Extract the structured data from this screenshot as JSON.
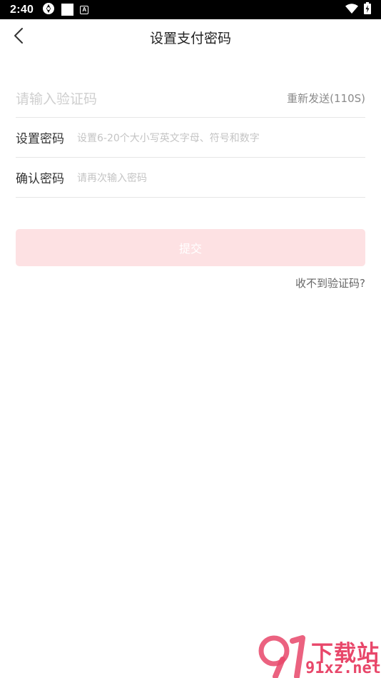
{
  "status_bar": {
    "time": "2:40",
    "icons_left": [
      "sync-icon",
      "white-square-icon",
      "app-notification-icon"
    ],
    "app_badge_letter": "A",
    "icons_right": [
      "wifi-icon",
      "battery-charging-icon"
    ]
  },
  "nav": {
    "title": "设置支付密码",
    "back_icon": "chevron-left-icon"
  },
  "form": {
    "code_placeholder": "请输入验证码",
    "resend_label": "重新发送(110S)",
    "set_password_label": "设置密码",
    "set_password_placeholder": "设置6-20个大小写英文字母、符号和数字",
    "confirm_password_label": "确认密码",
    "confirm_password_placeholder": "请再次输入密码"
  },
  "actions": {
    "submit_label": "提交",
    "no_code_link": "收不到验证码?"
  },
  "watermark": {
    "text_top": "下载站",
    "text_bottom": "91xz.net"
  },
  "colors": {
    "accent_disabled": "#fde1e3",
    "watermark": "#e8476a"
  }
}
